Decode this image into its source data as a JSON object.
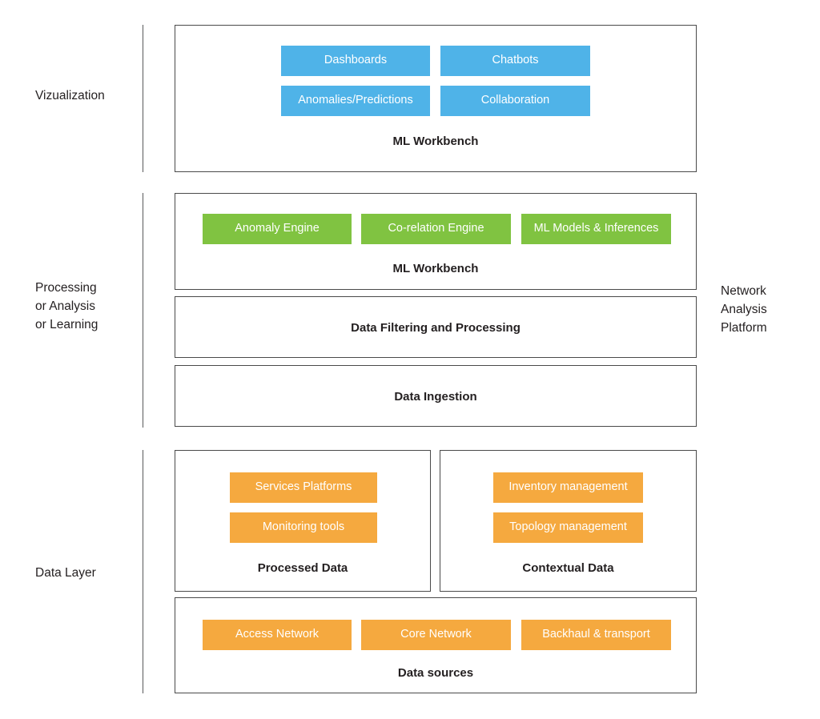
{
  "diagram": {
    "bands": {
      "visualization": {
        "label": "Vizualization",
        "panels": [
          {
            "caption": "ML Workbench",
            "chips": [
              {
                "label": "Dashboards",
                "color": "#4FB3E8"
              },
              {
                "label": "Chatbots",
                "color": "#4FB3E8"
              },
              {
                "label": "Anomalies/Predictions",
                "color": "#4FB3E8"
              },
              {
                "label": "Collaboration",
                "color": "#4FB3E8"
              }
            ]
          }
        ]
      },
      "processing": {
        "label": "Processing\nor Analysis\nor Learning",
        "panels": [
          {
            "caption": "ML Workbench",
            "chips": [
              {
                "label": "Anomaly Engine",
                "color": "#80C341"
              },
              {
                "label": "Co-relation Engine",
                "color": "#80C341"
              },
              {
                "label": "ML Models & Inferences",
                "color": "#80C341"
              }
            ]
          },
          {
            "caption": "Data Filtering and Processing",
            "chips": []
          },
          {
            "caption": "Data Ingestion",
            "chips": []
          }
        ]
      },
      "data_layer": {
        "label": "Data Layer",
        "panels": [
          {
            "caption": "Processed Data",
            "chips": [
              {
                "label": "Services Platforms",
                "color": "#F5A93F"
              },
              {
                "label": "Monitoring tools",
                "color": "#F5A93F"
              }
            ]
          },
          {
            "caption": "Contextual Data",
            "chips": [
              {
                "label": "Inventory management",
                "color": "#F5A93F"
              },
              {
                "label": "Topology management",
                "color": "#F5A93F"
              }
            ]
          },
          {
            "caption": "Data sources",
            "chips": [
              {
                "label": "Access Network",
                "color": "#F5A93F"
              },
              {
                "label": "Core Network",
                "color": "#F5A93F"
              },
              {
                "label": "Backhaul & transport",
                "color": "#F5A93F"
              }
            ]
          }
        ]
      }
    },
    "side_label": "Network\nAnalysis\nPlatform",
    "colors": {
      "blue": "#4FB3E8",
      "green": "#80C341",
      "orange": "#F5A93F",
      "border": "#4a4a4a",
      "divider": "#58595b",
      "text": "#231f20",
      "background": "#ffffff"
    }
  }
}
